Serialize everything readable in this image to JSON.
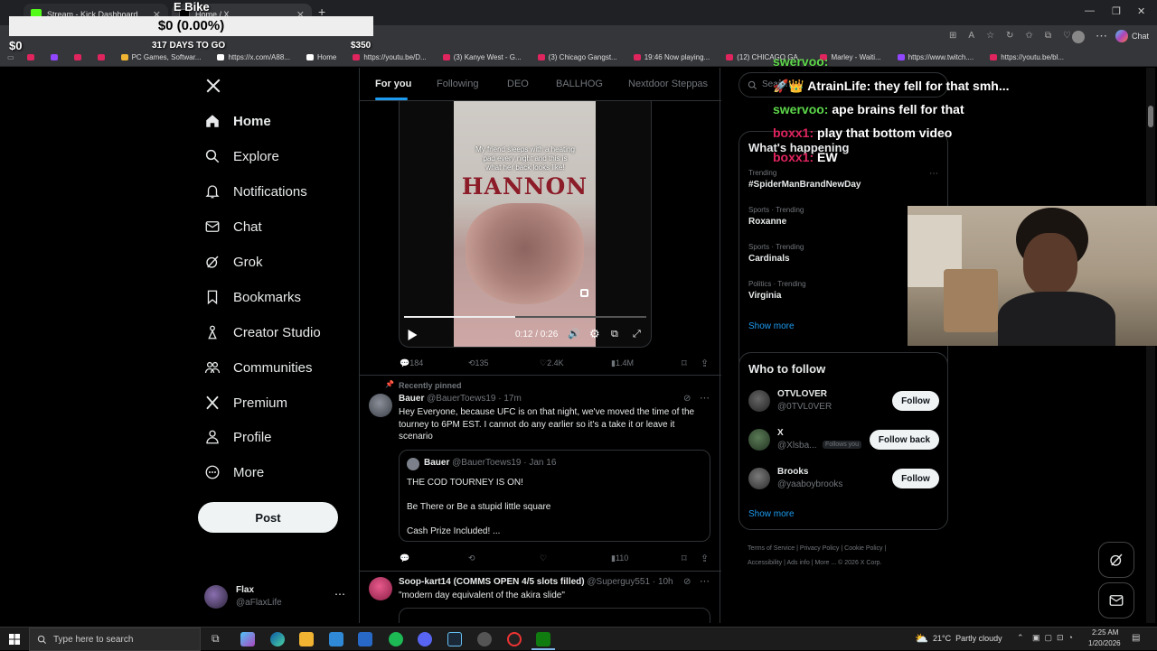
{
  "browser": {
    "tabs": [
      {
        "label": "Stream - Kick Dashboard"
      },
      {
        "label": "Home / X"
      }
    ],
    "bookmarks": [
      "PC Games, Softwar...",
      "https://x.com/A88...",
      "Home",
      "https://youtu.be/D...",
      "(3) Kanye West - G...",
      "(3) Chicago Gangst...",
      "19:46 Now playing...",
      "(12) CHICAGO GA...",
      "Marley - Waiti...",
      "https://www.twitch....",
      "https://youtu.be/bl..."
    ],
    "chat_label": "Chat"
  },
  "overlay": {
    "goal_title": "E Bike",
    "goal_amount": "$0 (0.00%)",
    "goal_start": "$0",
    "goal_days": "317 DAYS TO GO",
    "goal_target": "$350",
    "chat": [
      {
        "user": "swervoo:",
        "msg": ""
      },
      {
        "user": "",
        "msg": "AtrainLife: they fell for that smh..."
      },
      {
        "user": "swervoo:",
        "msg": "ape brains fell for that"
      },
      {
        "user": "boxx1:",
        "msg": "play that bottom video"
      },
      {
        "user": "boxx1:",
        "msg": "EW"
      }
    ],
    "colors": {
      "chat_user": "#5dd84a",
      "chat_user2": "#e0245e"
    }
  },
  "nav": {
    "items": [
      {
        "label": "Home",
        "icon": "home-icon"
      },
      {
        "label": "Explore",
        "icon": "search-icon"
      },
      {
        "label": "Notifications",
        "icon": "bell-icon"
      },
      {
        "label": "Chat",
        "icon": "mail-icon"
      },
      {
        "label": "Grok",
        "icon": "grok-icon"
      },
      {
        "label": "Bookmarks",
        "icon": "bookmark-icon"
      },
      {
        "label": "Creator Studio",
        "icon": "creator-icon"
      },
      {
        "label": "Communities",
        "icon": "people-icon"
      },
      {
        "label": "Premium",
        "icon": "x-logo-icon"
      },
      {
        "label": "Profile",
        "icon": "person-icon"
      },
      {
        "label": "More",
        "icon": "more-circle-icon"
      }
    ],
    "post_label": "Post",
    "account": {
      "name": "Flax",
      "handle": "@aFlaxLife"
    }
  },
  "feed": {
    "tabs": [
      "For you",
      "Following",
      "DEO",
      "BALLHOG",
      "Nextdoor Steppas"
    ],
    "video": {
      "caption": "My friend sleeps with a heating pad every night and this is what her back looks like!",
      "shirt_text": "HANNON",
      "time": "0:12 / 0:26",
      "progress": 0.46,
      "stats": {
        "replies": "184",
        "reposts": "135",
        "likes": "2.4K",
        "views": "1.4M"
      }
    },
    "pinned_label": "Recently pinned",
    "post1": {
      "name": "Bauer",
      "handle": "@BauerToews19",
      "time": "17m",
      "text": "Hey Everyone, because UFC is on that night, we've moved the time of the tourney to 6PM EST. I cannot do any earlier so it's a take it or leave it scenario",
      "quote": {
        "name": "Bauer",
        "handle": "@BauerToews19",
        "date": "Jan 16",
        "line1": "THE COD TOURNEY IS ON!",
        "line2": "Be There or Be a stupid little square",
        "line3": "Cash Prize Included! ..."
      },
      "views": "110"
    },
    "post2": {
      "name": "Soop-kart14 (COMMS OPEN 4/5 slots filled)",
      "handle": "@Superguy551",
      "time": "10h",
      "text": "\"modern day equivalent of the akira slide\""
    }
  },
  "sidebar": {
    "search_placeholder": "Search",
    "happening_title": "What's happening",
    "trends": [
      {
        "category": "Trending",
        "title": "#SpiderManBrandNewDay"
      },
      {
        "category": "Sports · Trending",
        "title": "Roxanne"
      },
      {
        "category": "Sports · Trending",
        "title": "Cardinals"
      },
      {
        "category": "Politics · Trending",
        "title": "Virginia"
      }
    ],
    "show_more": "Show more",
    "who_title": "Who to follow",
    "follow": [
      {
        "name": "OTVLOVER",
        "handle": "@0TVL0VER",
        "button": "Follow",
        "badge": ""
      },
      {
        "name": "X",
        "handle": "@Xlsba...",
        "button": "Follow back",
        "badge": "Follows you"
      },
      {
        "name": "Brooks",
        "handle": "@yaaboybrooks",
        "button": "Follow",
        "badge": ""
      }
    ],
    "footer": [
      "Terms of Service",
      "Privacy Policy",
      "Cookie Policy",
      "Accessibility",
      "Ads info",
      "More ...",
      "© 2026 X Corp."
    ]
  },
  "taskbar": {
    "search_placeholder": "Type here to search",
    "weather": "21°C  Partly cloudy",
    "time": "2:25 AM",
    "date": "1/20/2026"
  }
}
